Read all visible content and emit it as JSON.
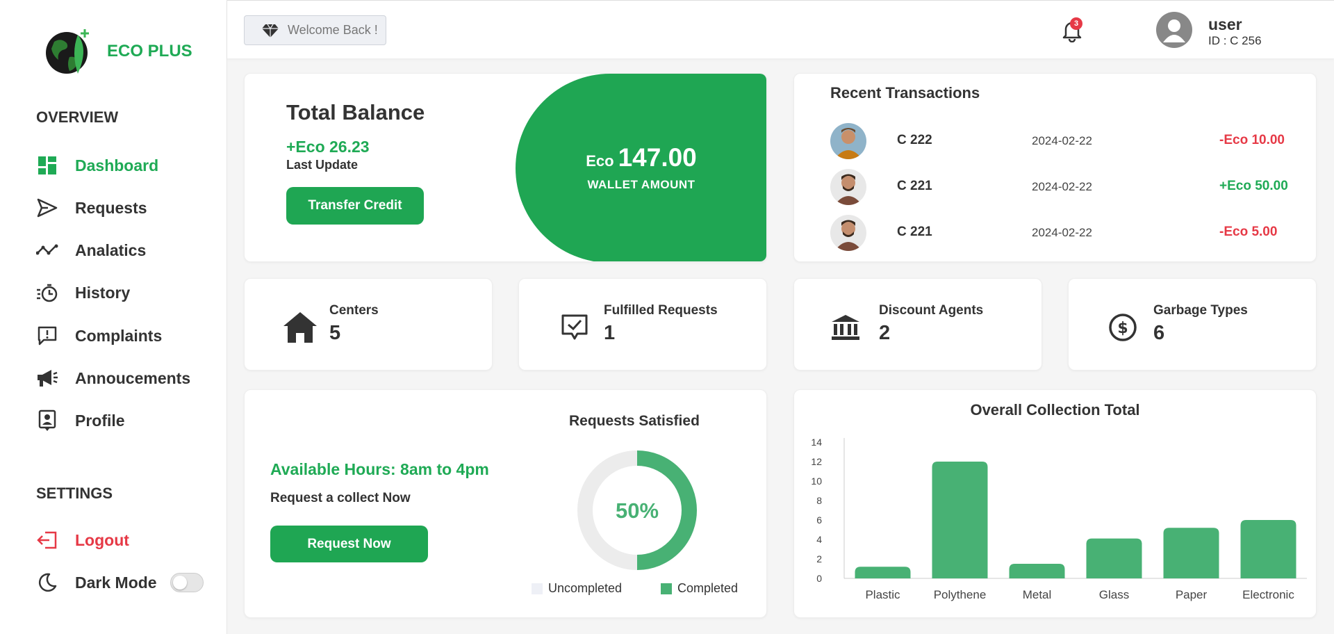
{
  "brand": {
    "name": "ECO PLUS"
  },
  "sidebar": {
    "overview_title": "OVERVIEW",
    "settings_title": "SETTINGS",
    "items": [
      {
        "label": "Dashboard",
        "icon": "dashboard-icon"
      },
      {
        "label": "Requests",
        "icon": "send-icon"
      },
      {
        "label": "Analatics",
        "icon": "analytics-icon"
      },
      {
        "label": "History",
        "icon": "history-icon"
      },
      {
        "label": "Complaints",
        "icon": "complaint-icon"
      },
      {
        "label": "Annoucements",
        "icon": "megaphone-icon"
      },
      {
        "label": "Profile",
        "icon": "profile-icon"
      }
    ],
    "logout_label": "Logout",
    "dark_mode_label": "Dark Mode",
    "dark_mode_on": false
  },
  "topbar": {
    "welcome": "Welcome Back !",
    "notifications": "3",
    "user_name": "user",
    "user_id": "ID : C 256"
  },
  "balance": {
    "title": "Total Balance",
    "change": "+Eco 26.23",
    "last_update": "Last Update",
    "transfer_label": "Transfer Credit",
    "wallet_currency": "Eco",
    "wallet_amount": "147.00",
    "wallet_label": "WALLET AMOUNT"
  },
  "transactions": {
    "title": "Recent Transactions",
    "rows": [
      {
        "id": "C 222",
        "date": "2024-02-22",
        "amount": "-Eco 10.00",
        "type": "debit"
      },
      {
        "id": "C 221",
        "date": "2024-02-22",
        "amount": "+Eco 50.00",
        "type": "credit"
      },
      {
        "id": "C 221",
        "date": "2024-02-22",
        "amount": "-Eco 5.00",
        "type": "debit"
      }
    ]
  },
  "stats": [
    {
      "label": "Centers",
      "value": "5",
      "icon": "home-icon"
    },
    {
      "label": "Fulfilled Requests",
      "value": "1",
      "icon": "check-message-icon"
    },
    {
      "label": "Discount Agents",
      "value": "2",
      "icon": "bank-icon"
    },
    {
      "label": "Garbage Types",
      "value": "6",
      "icon": "dollar-circle-icon"
    }
  ],
  "request": {
    "available_hours": "Available Hours: 8am to 4pm",
    "collect_text": "Request a collect Now",
    "button_label": "Request Now",
    "satisfied_title": "Requests Satisfied",
    "percent_label": "50%",
    "percent": 50,
    "legend_uncompleted": "Uncompleted",
    "legend_completed": "Completed"
  },
  "colors": {
    "accent": "#1fa653",
    "bar": "#48b174",
    "danger": "#e63946",
    "donut_bg": "#ececec"
  },
  "chart_data": {
    "type": "bar",
    "title": "Overall Collection Total",
    "categories": [
      "Plastic",
      "Polythene",
      "Metal",
      "Glass",
      "Paper",
      "Electronic"
    ],
    "values": [
      1.2,
      12,
      1.5,
      4.1,
      5.2,
      6
    ],
    "ylim": [
      0,
      14
    ],
    "yticks": [
      0,
      2,
      4,
      6,
      8,
      10,
      12,
      14
    ],
    "xlabel": "",
    "ylabel": "",
    "grid": false
  }
}
